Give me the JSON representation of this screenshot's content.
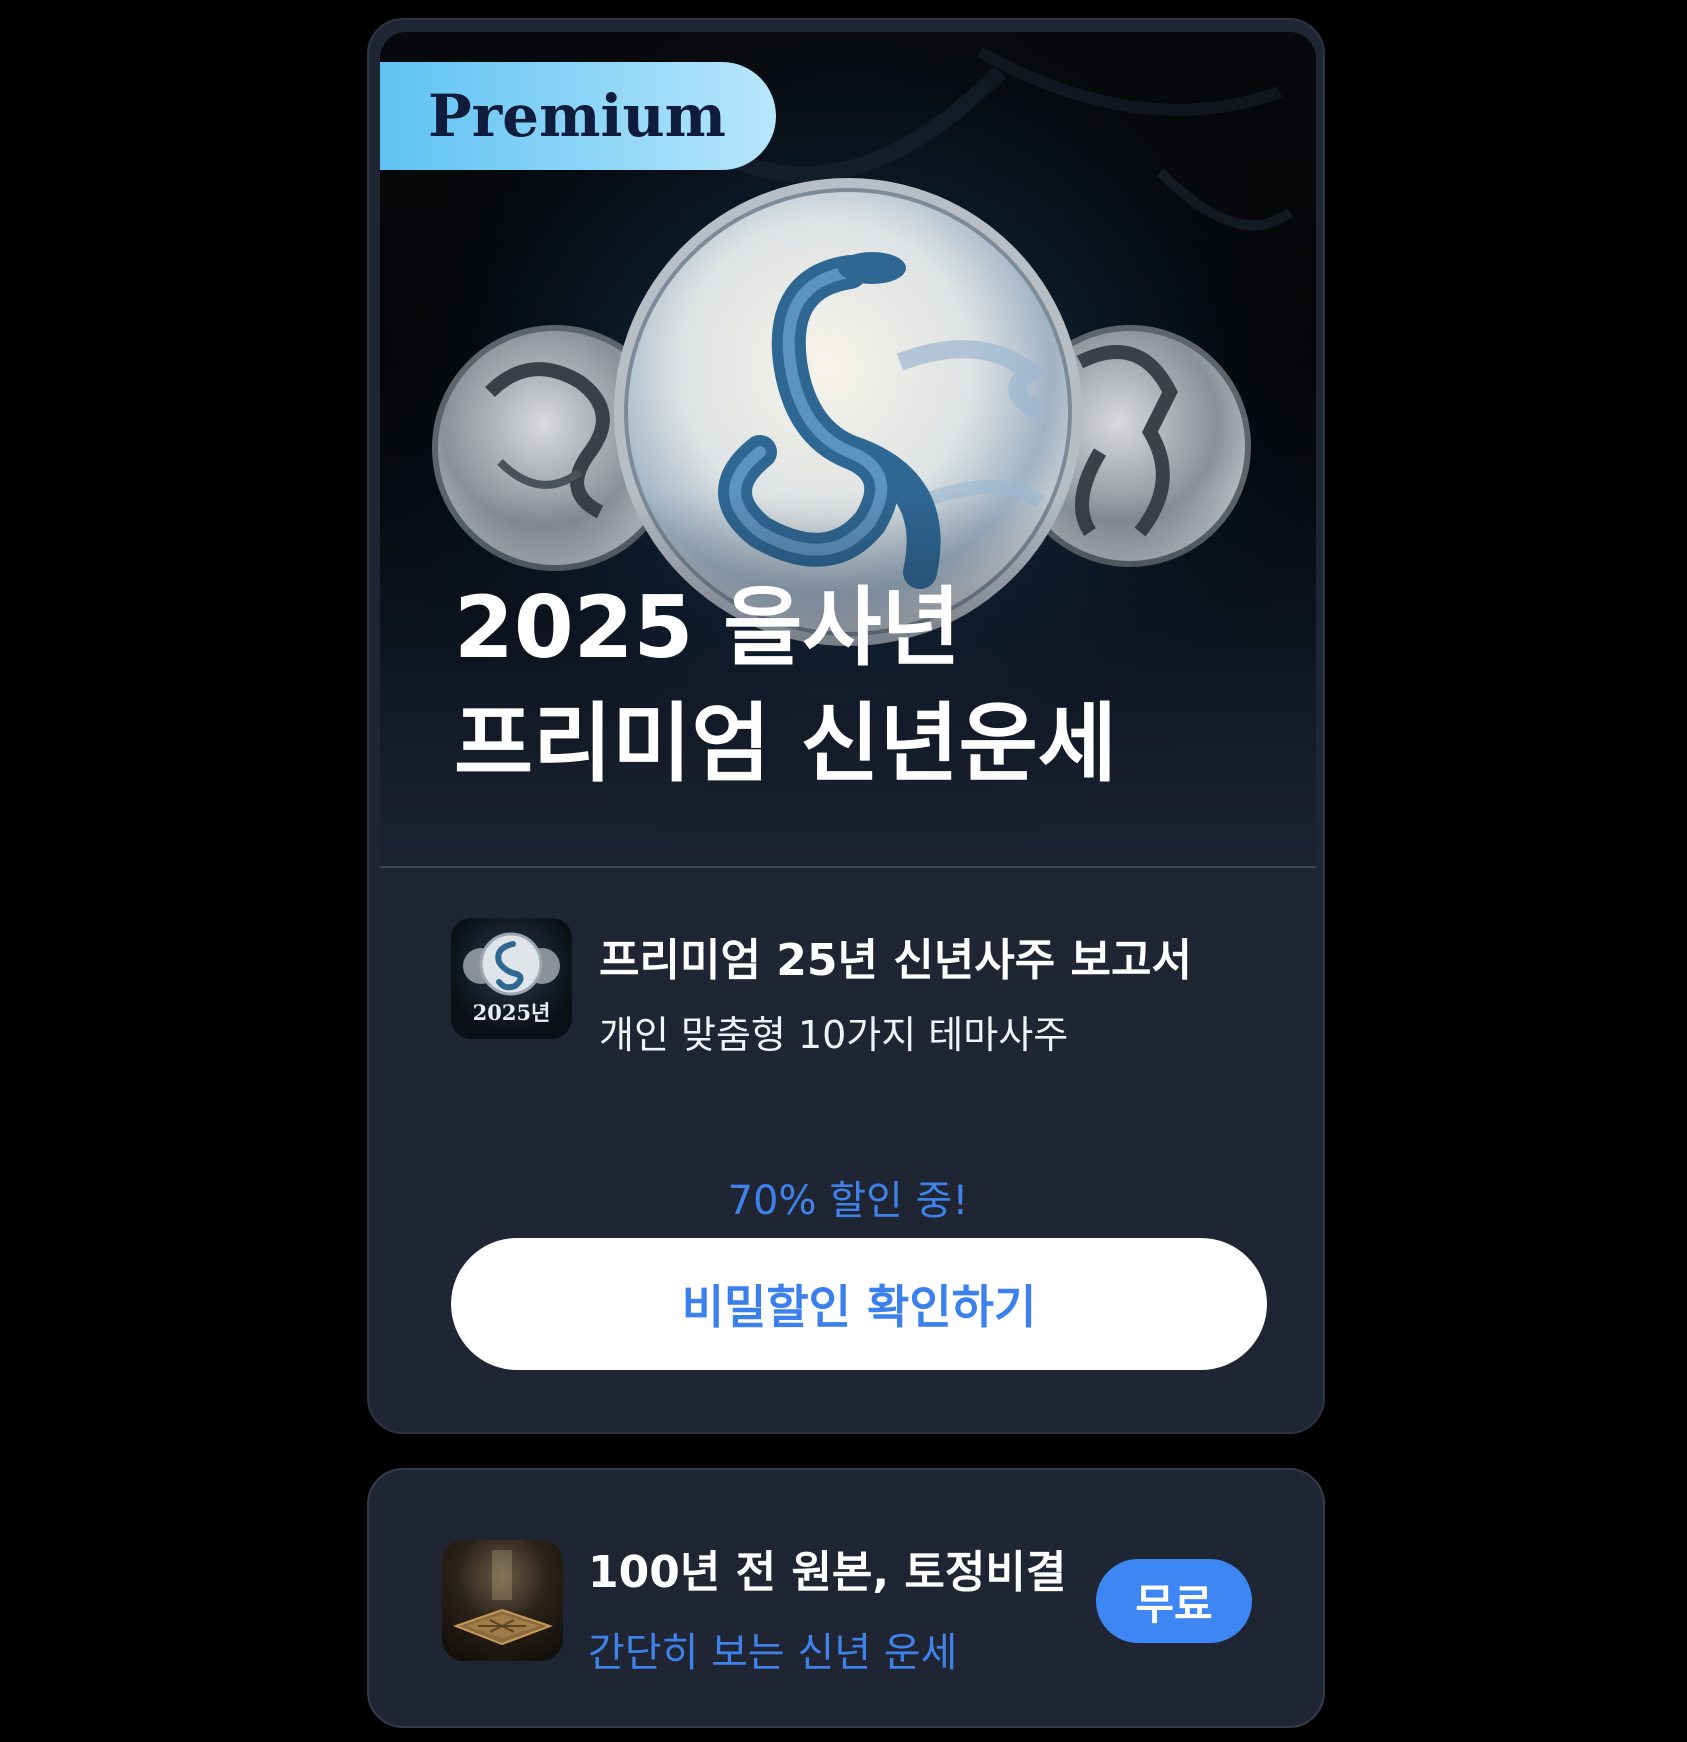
{
  "premium_card": {
    "badge": "Premium",
    "hero_title_line1": "2025 을사년",
    "hero_title_line2": "프리미엄 신년운세",
    "hero_image": "snake-dragon-horse-medallions",
    "product": {
      "thumb_icon": "snake-medallion-icon",
      "thumb_year": "2025년",
      "title": "프리미엄 25년 신년사주 보고서",
      "subtitle": "개인 맞춤형 10가지 테마사주"
    },
    "discount_text": "70% 할인 중!",
    "cta_label": "비밀할인 확인하기"
  },
  "free_card": {
    "thumb_icon": "ancient-book-icon",
    "title": "100년 전 원본, 토정비결",
    "subtitle": "간단히 보는 신년 운세",
    "button_label": "무료"
  },
  "colors": {
    "background": "#000000",
    "card": "#1f2533",
    "accent_blue": "#3e86f4",
    "badge_gradient_start": "#5fc2f2",
    "badge_gradient_end": "#b7e6fb"
  }
}
